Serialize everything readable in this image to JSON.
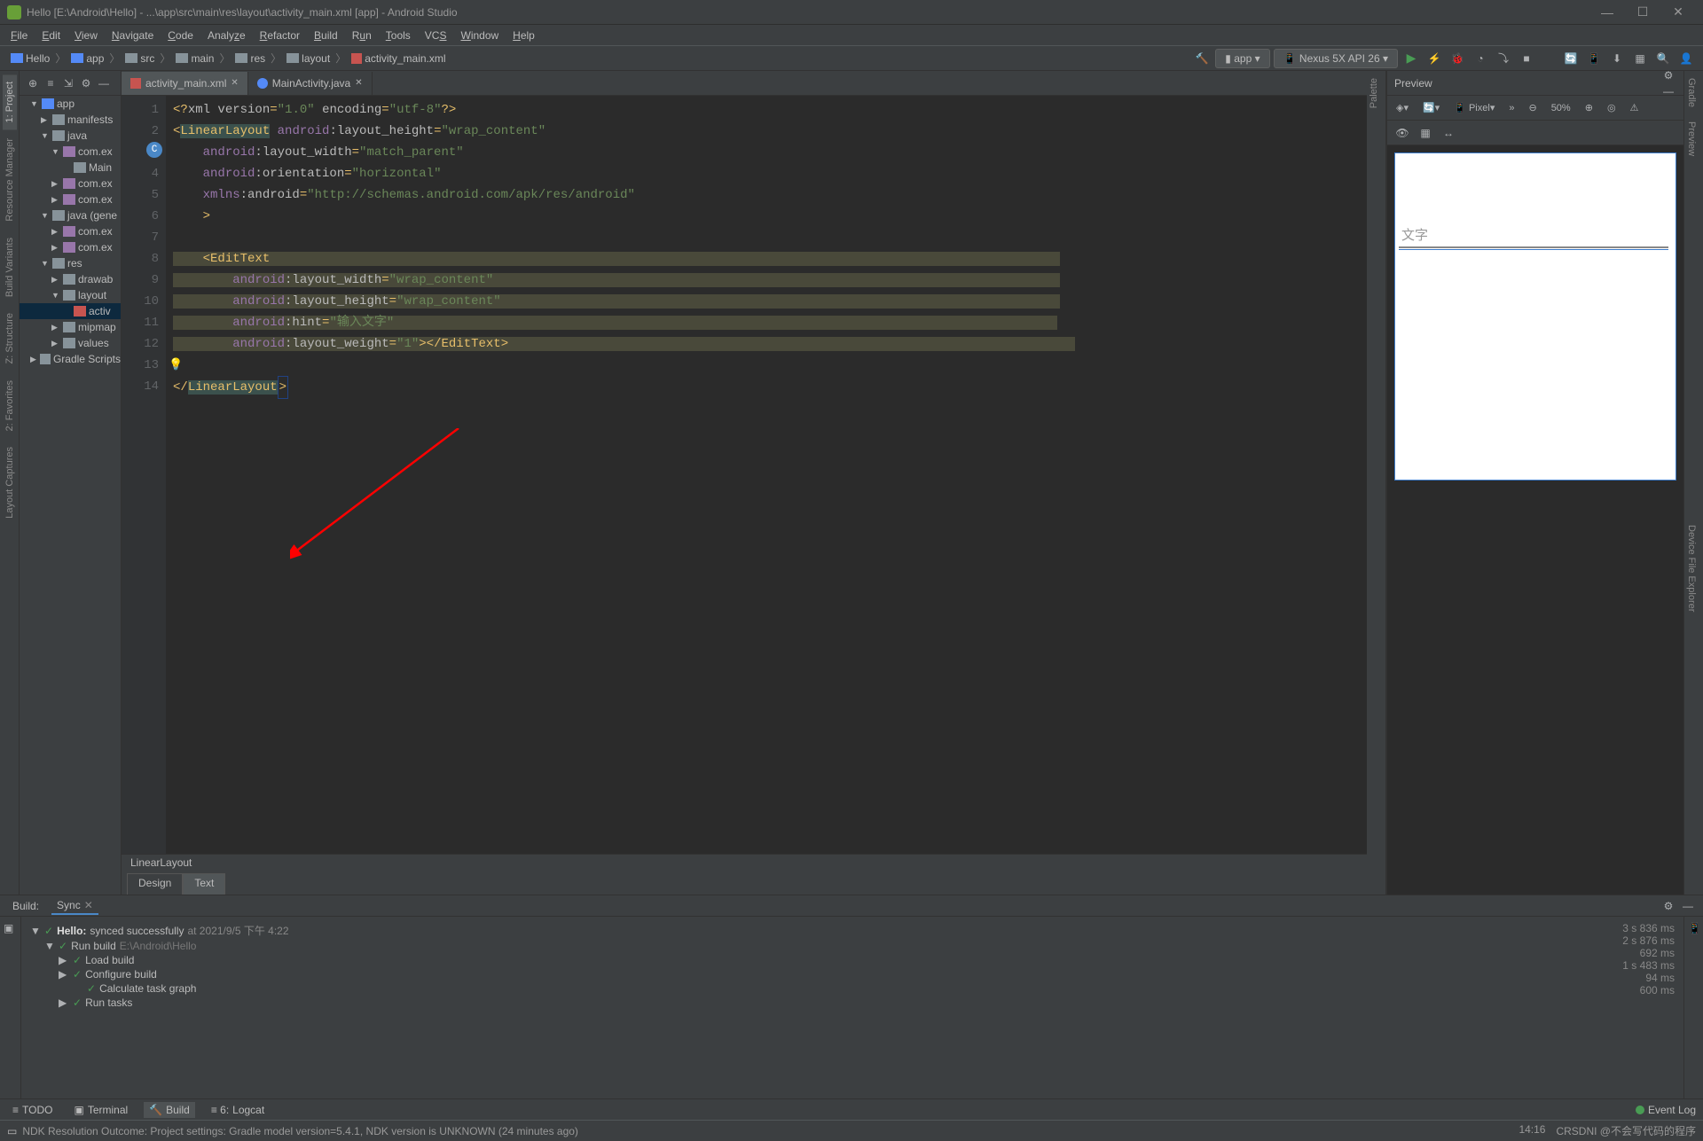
{
  "window": {
    "title": "Hello [E:\\Android\\Hello] - ...\\app\\src\\main\\res\\layout\\activity_main.xml [app] - Android Studio"
  },
  "menu": [
    "File",
    "Edit",
    "View",
    "Navigate",
    "Code",
    "Analyze",
    "Refactor",
    "Build",
    "Run",
    "Tools",
    "VCS",
    "Window",
    "Help"
  ],
  "breadcrumb": [
    "Hello",
    "app",
    "src",
    "main",
    "res",
    "layout",
    "activity_main.xml"
  ],
  "runConfig": "app",
  "device": "Nexus 5X API 26",
  "leftRail": [
    "1: Project",
    "Resource Manager",
    "Build Variants",
    "Z: Structure",
    "2: Favorites",
    "Layout Captures"
  ],
  "rightRail": [
    "Gradle",
    "Preview",
    "Device File Explorer"
  ],
  "projectTree": {
    "root": "app",
    "items": [
      {
        "indent": 1,
        "arrow": "▼",
        "icon": "app",
        "label": "app"
      },
      {
        "indent": 2,
        "arrow": "▶",
        "icon": "folder",
        "label": "manifests"
      },
      {
        "indent": 2,
        "arrow": "▼",
        "icon": "folder",
        "label": "java"
      },
      {
        "indent": 3,
        "arrow": "▼",
        "icon": "pkg",
        "label": "com.ex"
      },
      {
        "indent": 4,
        "arrow": "",
        "icon": "cls",
        "label": "Main"
      },
      {
        "indent": 3,
        "arrow": "▶",
        "icon": "pkg",
        "label": "com.ex"
      },
      {
        "indent": 3,
        "arrow": "▶",
        "icon": "pkg",
        "label": "com.ex"
      },
      {
        "indent": 2,
        "arrow": "▼",
        "icon": "folder",
        "label": "java (gene"
      },
      {
        "indent": 3,
        "arrow": "▶",
        "icon": "pkg",
        "label": "com.ex"
      },
      {
        "indent": 3,
        "arrow": "▶",
        "icon": "pkg",
        "label": "com.ex"
      },
      {
        "indent": 2,
        "arrow": "▼",
        "icon": "folder",
        "label": "res"
      },
      {
        "indent": 3,
        "arrow": "▶",
        "icon": "folder",
        "label": "drawab"
      },
      {
        "indent": 3,
        "arrow": "▼",
        "icon": "folder",
        "label": "layout"
      },
      {
        "indent": 4,
        "arrow": "",
        "icon": "xml",
        "label": "activ",
        "selected": true
      },
      {
        "indent": 3,
        "arrow": "▶",
        "icon": "folder",
        "label": "mipmap"
      },
      {
        "indent": 3,
        "arrow": "▶",
        "icon": "folder",
        "label": "values"
      },
      {
        "indent": 1,
        "arrow": "▶",
        "icon": "gradle",
        "label": "Gradle Scripts"
      }
    ]
  },
  "editorTabs": [
    {
      "icon": "xml",
      "label": "activity_main.xml",
      "active": true
    },
    {
      "icon": "java",
      "label": "MainActivity.java",
      "active": false
    }
  ],
  "codeLines": 14,
  "editorFooter": "LinearLayout",
  "designTabs": [
    "Design",
    "Text"
  ],
  "preview": {
    "title": "Preview",
    "device": "Pixel",
    "zoom": "50%",
    "hintText": "文字"
  },
  "build": {
    "tabs": [
      "Build:",
      "Sync"
    ],
    "lines": [
      {
        "indent": 0,
        "prefix": "▼",
        "check": true,
        "bold": "Hello:",
        "text": "synced successfully",
        "time_suffix": "at 2021/9/5 下午 4:22",
        "duration": "3 s 836 ms"
      },
      {
        "indent": 1,
        "prefix": "▼",
        "check": true,
        "text": "Run build",
        "gray": "E:\\Android\\Hello",
        "duration": "2 s 876 ms"
      },
      {
        "indent": 2,
        "prefix": "▶",
        "check": true,
        "text": "Load build",
        "duration": "692 ms"
      },
      {
        "indent": 2,
        "prefix": "▶",
        "check": true,
        "text": "Configure build",
        "duration": "1 s 483 ms"
      },
      {
        "indent": 3,
        "prefix": "",
        "check": true,
        "text": "Calculate task graph",
        "duration": "94 ms"
      },
      {
        "indent": 2,
        "prefix": "▶",
        "check": true,
        "text": "Run tasks",
        "duration": "600 ms"
      }
    ]
  },
  "bottomTools": [
    "TODO",
    "Terminal",
    "Build",
    "Logcat"
  ],
  "eventLog": "Event Log",
  "statusbar": {
    "msg": "NDK Resolution Outcome: Project settings: Gradle model version=5.4.1, NDK version is UNKNOWN (24 minutes ago)",
    "time": "14:16",
    "watermark": "CRSDNI @不会写代码的程序"
  }
}
